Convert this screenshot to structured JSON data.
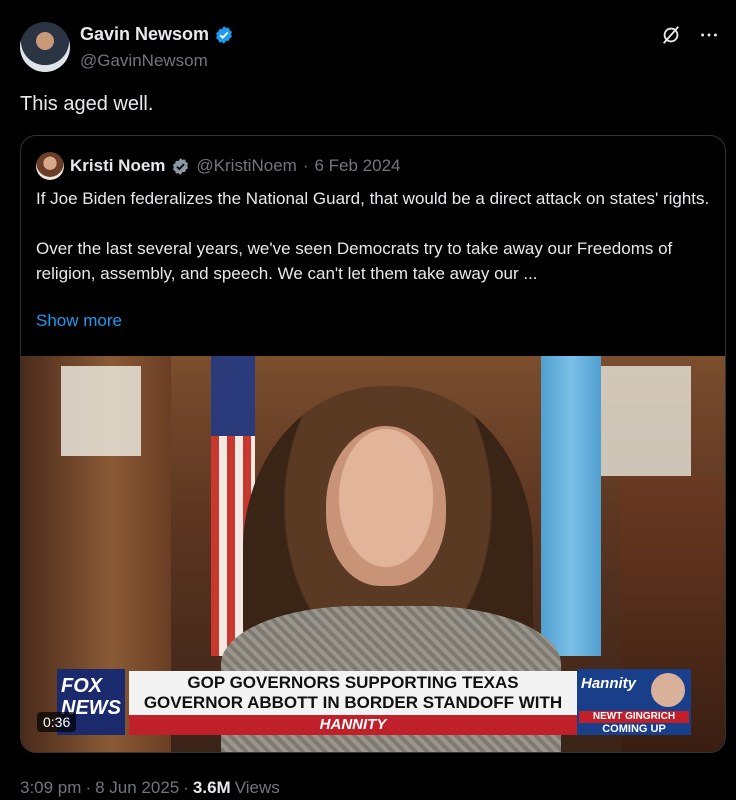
{
  "author": {
    "name": "Gavin Newsom",
    "handle": "@GavinNewsom",
    "verified_icon": "verified-badge-icon"
  },
  "tweet": {
    "text": "This aged well."
  },
  "quoted": {
    "name": "Kristi Noem",
    "handle": "@KristiNoem",
    "separator": "·",
    "date": "6 Feb 2024",
    "body": "If Joe Biden federalizes the National Guard, that would be a direct attack on states' rights.\n\nOver the last several years, we've seen Democrats try to take away our Freedoms of religion, assembly, and speech. We can't let them take away our ...",
    "show_more": "Show more",
    "media": {
      "duration": "0:36",
      "network_logo_top": "FOX",
      "network_logo_bottom": "NEWS",
      "headline_line1": "GOP GOVERNORS SUPPORTING TEXAS",
      "headline_line2": "GOVERNOR ABBOTT IN BORDER STANDOFF WITH BIDEN",
      "show_name": "HANNITY",
      "promo_brand": "Hannity",
      "promo_line1": "NEWT GINGRICH",
      "promo_line2": "COMING UP"
    }
  },
  "footer": {
    "time": "3:09 pm",
    "sep1": "·",
    "date": "8 Jun 2025",
    "sep2": "·",
    "views_count": "3.6M",
    "views_label": "Views"
  },
  "colors": {
    "background": "#000000",
    "text": "#e7e9ea",
    "muted": "#71767b",
    "link": "#1d9bf0",
    "verified": "#1d9bf0"
  }
}
